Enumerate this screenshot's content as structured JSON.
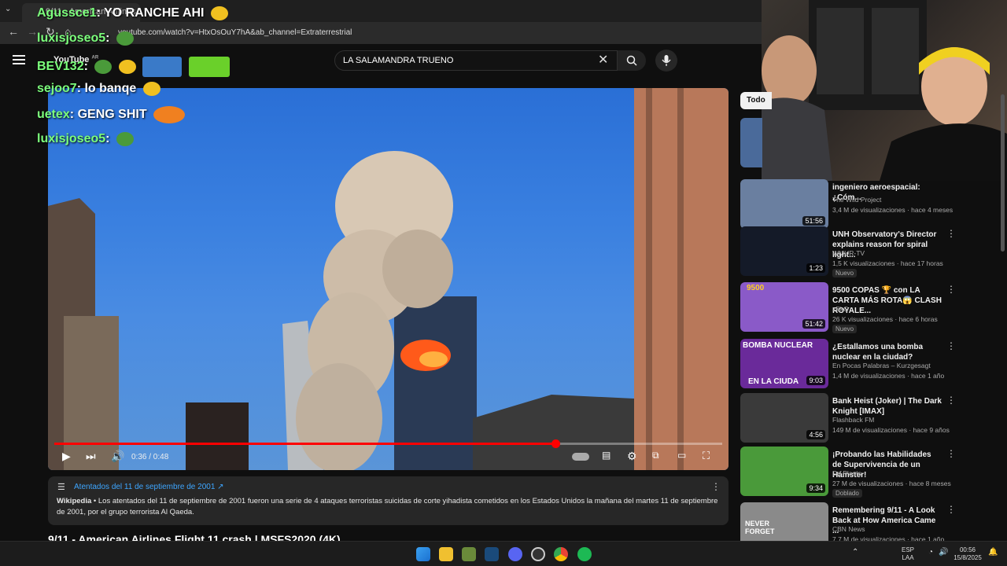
{
  "browser": {
    "tab_title": "9/11 - American Airlines...",
    "url": "youtube.com/watch?v=HtxOsOuY7hA&ab_channel=Extraterrestrial"
  },
  "youtube": {
    "logo": "YouTube",
    "country": "AR",
    "search_value": "LA SALAMANDRA TRUENO"
  },
  "chat": [
    {
      "user": "Agussce1",
      "message": "YO RANCHE AHI"
    },
    {
      "user": "luxisjoseo5",
      "message": ""
    },
    {
      "user": "BEV132",
      "message": ""
    },
    {
      "user": "sejoo7",
      "message": "lo banqe"
    },
    {
      "user": "uetex",
      "message": "GENG SHIT"
    },
    {
      "user": "luxisjoseo5",
      "message": ""
    }
  ],
  "player": {
    "time": "0:36 / 0:48",
    "progress": 0.75
  },
  "description": {
    "link_title": "Atentados del 11 de septiembre de 2001",
    "source": "Wikipedia",
    "text": "Los atentados del 11 de septiembre de 2001 fueron una serie de 4 ataques terroristas suicidas de corte yihadista cometidos en los Estados Unidos la mañana del martes 11 de septiembre de 2001, por el grupo terrorista Al Qaeda."
  },
  "video_title": "9/11 - American Airlines Flight 11 crash | MSFS2020 (4K)",
  "sidebar": {
    "chip": "Todo",
    "items": [
      {
        "title": "ingeniero aeroespacial: ¿Cóm...",
        "channel": "The Wild Project",
        "meta": "3,4 M de visualizaciones · hace 4 meses",
        "duration": "51:56",
        "badge": "",
        "color": "#6a7fa0"
      },
      {
        "title": "UNH Observatory's Director explains reason for spiral light...",
        "channel": "WMUR-TV",
        "meta": "1,5 K visualizaciones · hace 17 horas",
        "duration": "1:23",
        "badge": "Nuevo",
        "color": "#141a28"
      },
      {
        "title": "9500 COPAS 🏆 con LA CARTA MÁS ROTA😱 CLASH ROYALE...",
        "channel": "zEkO",
        "meta": "26 K visualizaciones · hace 6 horas",
        "duration": "51:42",
        "badge": "Nuevo",
        "color": "#8a5ac8"
      },
      {
        "title": "¿Estallamos una bomba nuclear en la ciudad?",
        "channel": "En Pocas Palabras – Kurzgesagt",
        "meta": "1,4 M de visualizaciones · hace 1 año",
        "duration": "9:03",
        "badge": "",
        "color": "#6a2a9a"
      },
      {
        "title": "Bank Heist (Joker) | The Dark Knight [IMAX]",
        "channel": "Flashback FM",
        "meta": "149 M de visualizaciones · hace 9 años",
        "duration": "4:56",
        "badge": "",
        "color": "#3a3a3a"
      },
      {
        "title": "¡Probando las Habilidades de Supervivencia de un Hámster!",
        "channel": "Dr. Plants",
        "meta": "27 M de visualizaciones · hace 8 meses",
        "duration": "9:34",
        "badge": "Doblado",
        "color": "#4a9a3a"
      },
      {
        "title": "Remembering 9/11 - A Look Back at How America Came ...",
        "channel": "CBN News",
        "meta": "7,7 M de visualizaciones · hace 1 año",
        "duration": "",
        "badge": "",
        "color": "#8a8a8a"
      }
    ],
    "thumb_texts": [
      "BOMBA NUCLEAR",
      "EN LA CIUDA",
      "NEVER FORGET",
      "9500"
    ]
  },
  "taskbar": {
    "lang_top": "ESP",
    "lang_bottom": "LAA",
    "time": "00:56",
    "date": "15/8/2025"
  }
}
